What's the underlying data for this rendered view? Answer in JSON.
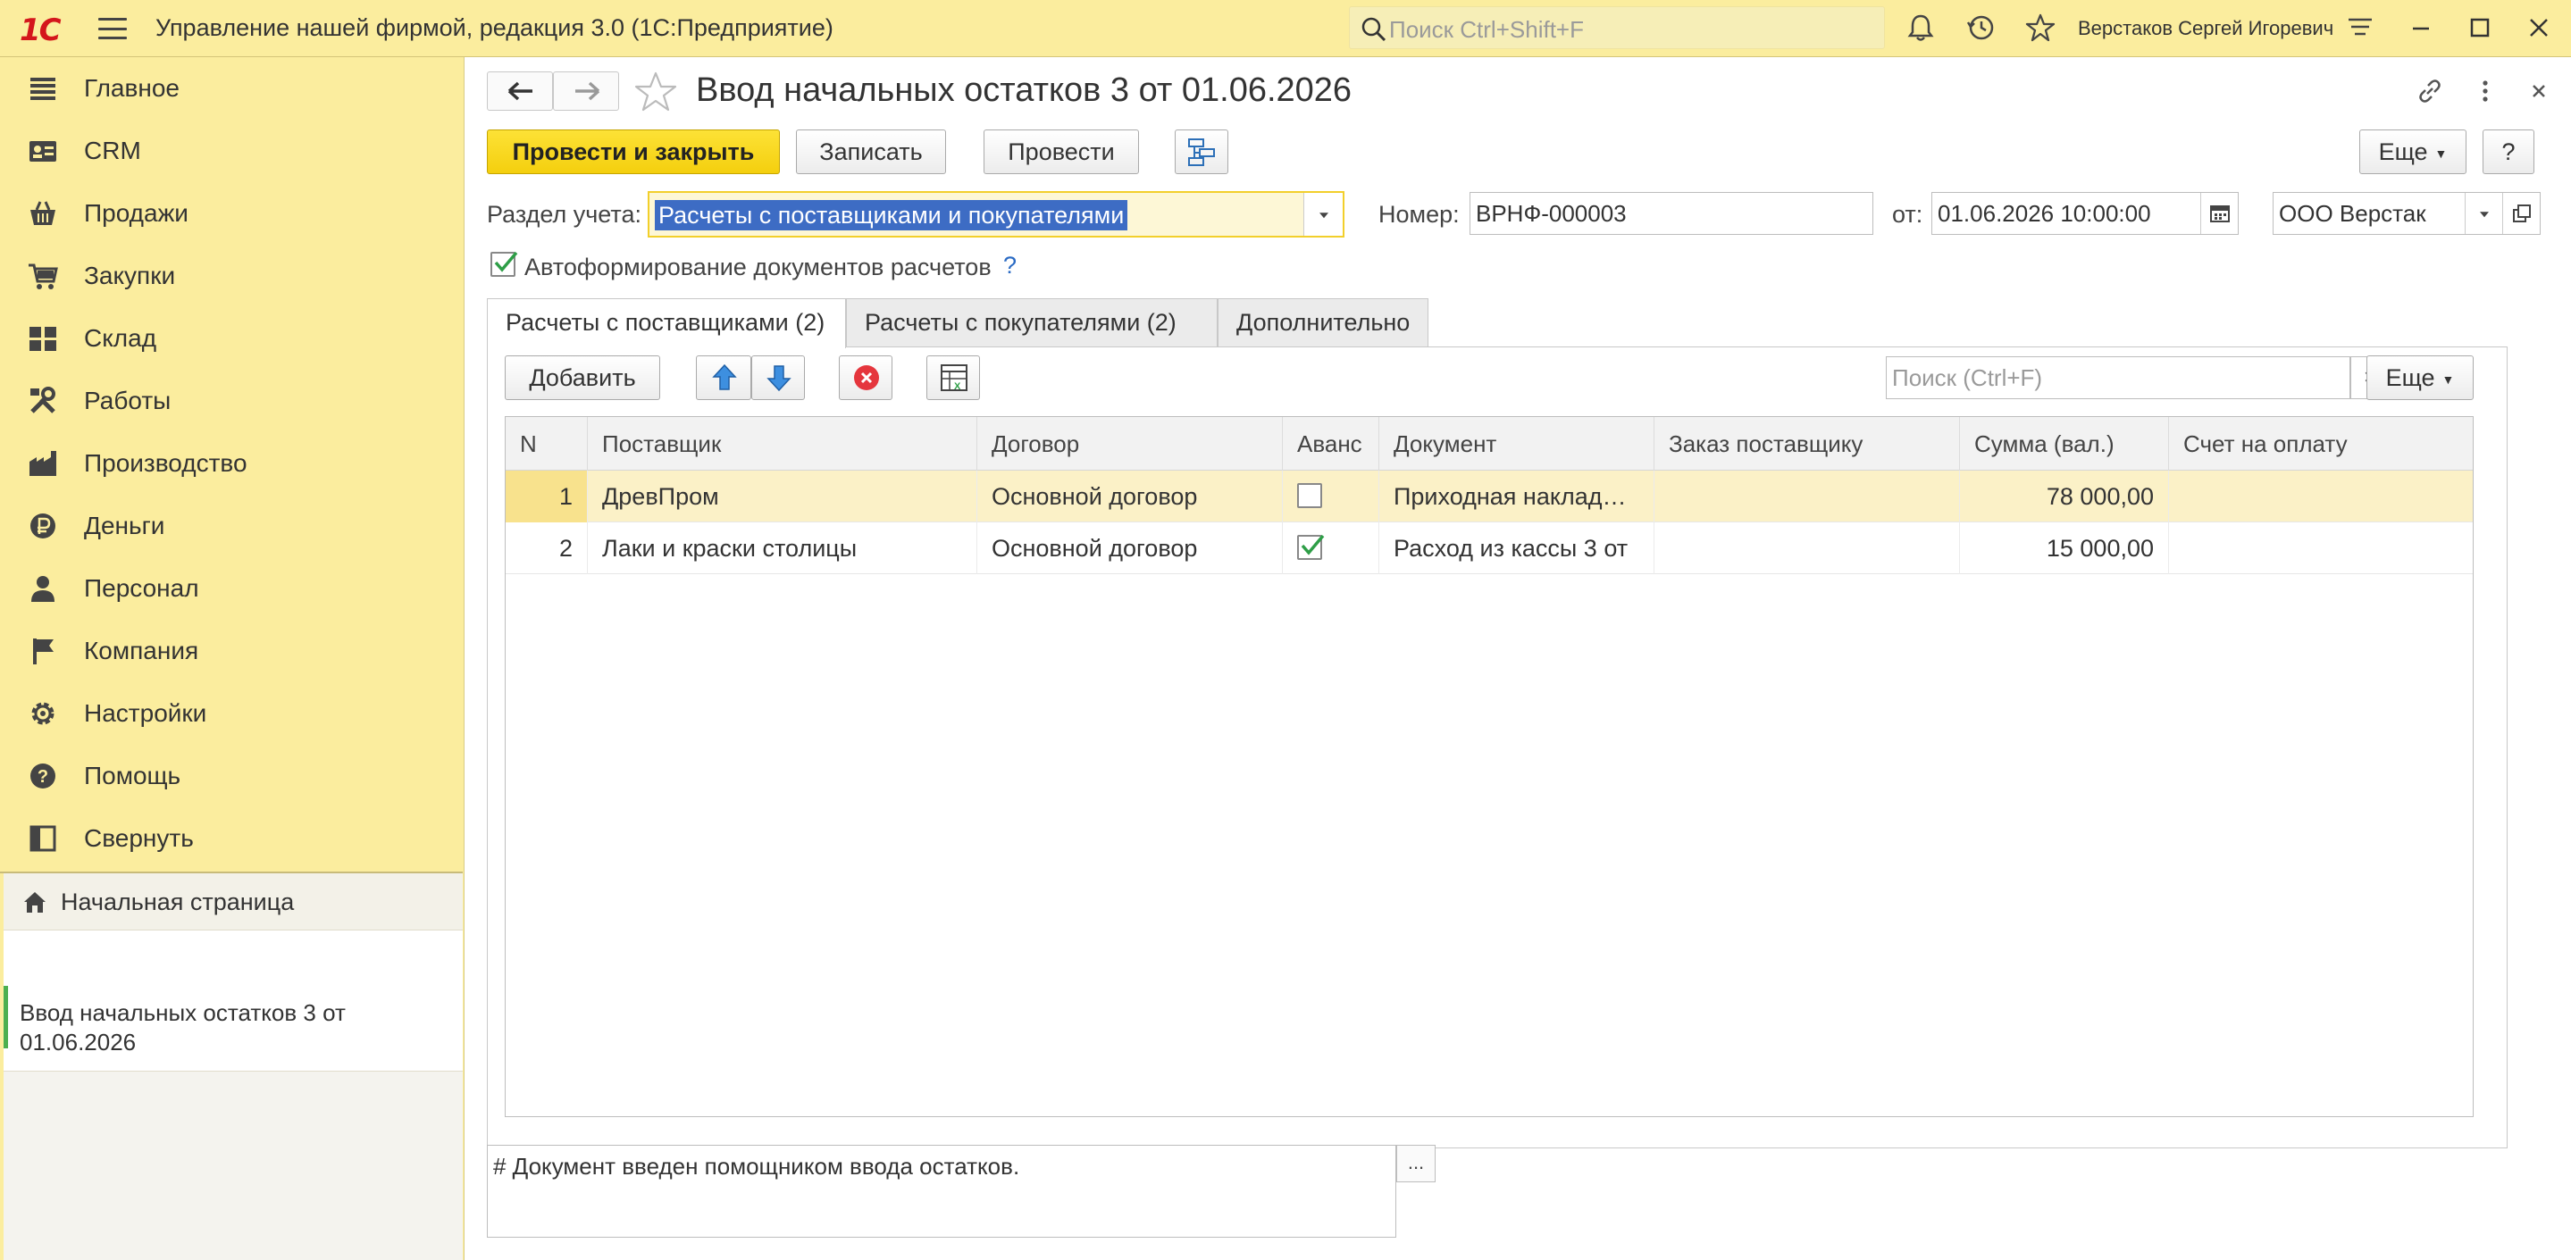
{
  "titlebar": {
    "logo": "1С",
    "app_title": "Управление нашей фирмой, редакция 3.0  (1С:Предприятие)",
    "search_placeholder": "Поиск Ctrl+Shift+F",
    "user_name": "Верстаков Сергей Игоревич"
  },
  "sidebar": {
    "items": [
      {
        "label": "Главное",
        "icon": "menu-lines-icon"
      },
      {
        "label": "CRM",
        "icon": "crm-card-icon"
      },
      {
        "label": "Продажи",
        "icon": "basket-icon"
      },
      {
        "label": "Закупки",
        "icon": "cart-icon"
      },
      {
        "label": "Склад",
        "icon": "warehouse-grid-icon"
      },
      {
        "label": "Работы",
        "icon": "tools-icon"
      },
      {
        "label": "Производство",
        "icon": "factory-icon"
      },
      {
        "label": "Деньги",
        "icon": "ruble-coin-icon"
      },
      {
        "label": "Персонал",
        "icon": "person-icon"
      },
      {
        "label": "Компания",
        "icon": "flag-icon"
      },
      {
        "label": "Настройки",
        "icon": "gear-icon"
      },
      {
        "label": "Помощь",
        "icon": "help-icon"
      },
      {
        "label": "Свернуть",
        "icon": "collapse-panel-icon"
      }
    ],
    "home_label": "Начальная страница",
    "open_doc_label": "Ввод начальных остатков 3 от 01.06.2026"
  },
  "document": {
    "title": "Ввод начальных остатков 3 от 01.06.2026",
    "buttons": {
      "post_and_close": "Провести и закрыть",
      "save": "Записать",
      "post": "Провести",
      "more": "Еще",
      "help": "?"
    },
    "section_label": "Раздел учета:",
    "section_value": "Расчеты с поставщиками и покупателями",
    "number_label": "Номер:",
    "number_value": "ВРНФ-000003",
    "date_label": "от:",
    "date_value": "01.06.2026 10:00:00",
    "organization_value": "ООО Верстак",
    "auto_docs_label": "Автоформирование документов расчетов",
    "auto_docs_checked": true,
    "auto_docs_help": "?"
  },
  "tabs": [
    {
      "label": "Расчеты с поставщиками (2)",
      "active": true
    },
    {
      "label": "Расчеты с покупателями (2)",
      "active": false
    },
    {
      "label": "Дополнительно",
      "active": false
    }
  ],
  "table_toolbar": {
    "add_label": "Добавить",
    "search_placeholder": "Поиск (Ctrl+F)",
    "clear_label": "×",
    "more_label": "Еще"
  },
  "table": {
    "columns": [
      "N",
      "Поставщик",
      "Договор",
      "Аванс",
      "Документ",
      "Заказ поставщику",
      "Сумма (вал.)",
      "Счет на оплату"
    ],
    "rows": [
      {
        "n": "1",
        "supplier": "ДревПром",
        "contract": "Основной договор",
        "advance": false,
        "document": "Приходная накладная",
        "order": "",
        "amount": "78 000,00",
        "invoice": ""
      },
      {
        "n": "2",
        "supplier": "Лаки и краски столицы",
        "contract": "Основной договор",
        "advance": true,
        "document": "Расход из кассы 3 от",
        "order": "",
        "amount": "15 000,00",
        "invoice": ""
      }
    ]
  },
  "comment": {
    "text": "# Документ введен помощником ввода остатков.",
    "button_label": "..."
  },
  "colors": {
    "panel_yellow": "#fbed9e",
    "primary_button": "#f4cf0e",
    "selection_blue": "#3d6cc4",
    "check_green": "#2e9e47",
    "logo_red": "#d4161c"
  }
}
